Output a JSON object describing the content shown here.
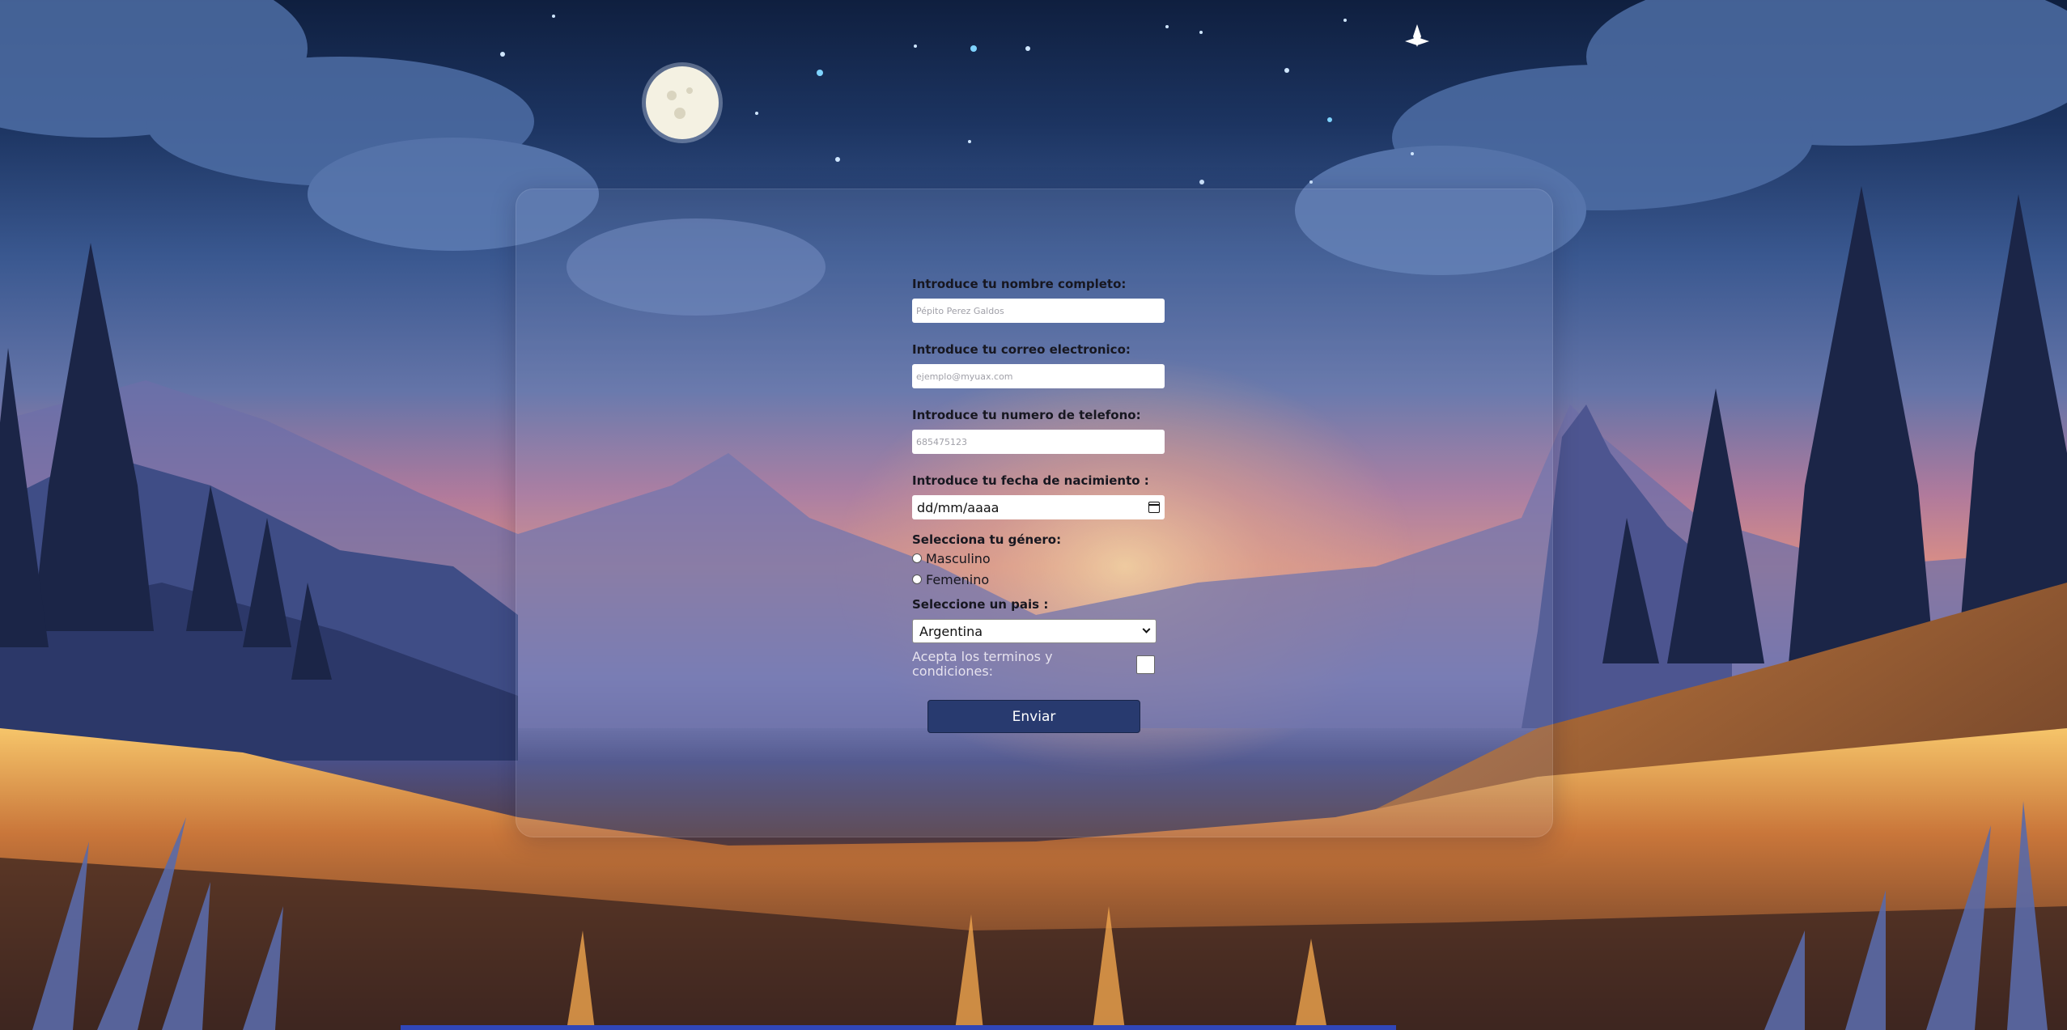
{
  "form": {
    "name_label": "Introduce tu nombre completo:",
    "name_placeholder": "Pépito Perez Galdos",
    "email_label": "Introduce tu correo electronico:",
    "email_placeholder": "ejemplo@myuax.com",
    "phone_label": "Introduce tu numero de telefono:",
    "phone_placeholder": "685475123",
    "birth_label": "Introduce tu fecha de nacimiento :",
    "birth_value": "dd/mm/aaaa",
    "gender_label": "Selecciona tu género:",
    "gender_options": [
      "Masculino",
      "Femenino"
    ],
    "country_label": "Seleccione un pais :",
    "country_selected": "Argentina",
    "terms_label": "Acepta los terminos y condiciones:",
    "submit_label": "Enviar"
  },
  "colors": {
    "submit_bg": "#283a6f",
    "label_text": "#171720",
    "terms_text": "#e6e2ee"
  },
  "icons": {
    "date_picker": "calendar-icon",
    "select_arrow": "chevron-down-icon"
  }
}
